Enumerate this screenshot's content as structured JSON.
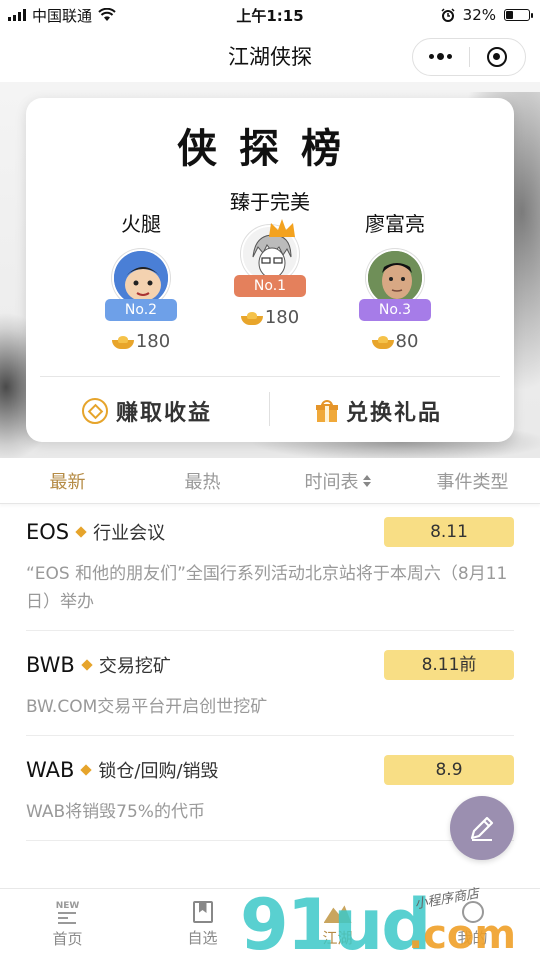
{
  "status": {
    "carrier": "中国联通",
    "time": "上午1:15",
    "battery": "32%",
    "battery_level": 0.32
  },
  "nav": {
    "title": "江湖侠探"
  },
  "leaderboard": {
    "title": "侠探榜",
    "players": [
      {
        "name": "火腿",
        "rank": "No.2",
        "score": "180",
        "rank_color": "#6ea0e8"
      },
      {
        "name": "臻于完美",
        "rank": "No.1",
        "score": "180",
        "rank_color": "#e4805c"
      },
      {
        "name": "廖富亮",
        "rank": "No.3",
        "score": "80",
        "rank_color": "#a67ce8"
      }
    ],
    "actions": {
      "earn": "赚取收益",
      "redeem": "兑换礼品"
    }
  },
  "tabs": [
    {
      "label": "最新"
    },
    {
      "label": "最热"
    },
    {
      "label": "时间表"
    },
    {
      "label": "事件类型"
    }
  ],
  "events": [
    {
      "coin": "EOS",
      "type": "行业会议",
      "date": "8.11",
      "desc": "“EOS 和他的朋友们”全国行系列活动北京站将于本周六（8月11日）举办"
    },
    {
      "coin": "BWB",
      "type": "交易挖矿",
      "date": "8.11前",
      "desc": "BW.COM交易平台开启创世挖矿"
    },
    {
      "coin": "WAB",
      "type": "锁仓/回购/销毁",
      "date": "8.9",
      "desc": "WAB将销毁75%的代币"
    }
  ],
  "bottom_nav": {
    "new_badge": "NEW",
    "items": [
      {
        "label": "首页"
      },
      {
        "label": "自选"
      },
      {
        "label": "江湖"
      },
      {
        "label": "我的"
      }
    ]
  },
  "watermark": {
    "number": "91ud",
    "domain": ".com",
    "handwriting": "小程序商店"
  },
  "colors": {
    "accent": "#b58b45",
    "date_bg": "#f8de85",
    "fab": "#9b8fb0",
    "gold": "#e6a42b"
  }
}
